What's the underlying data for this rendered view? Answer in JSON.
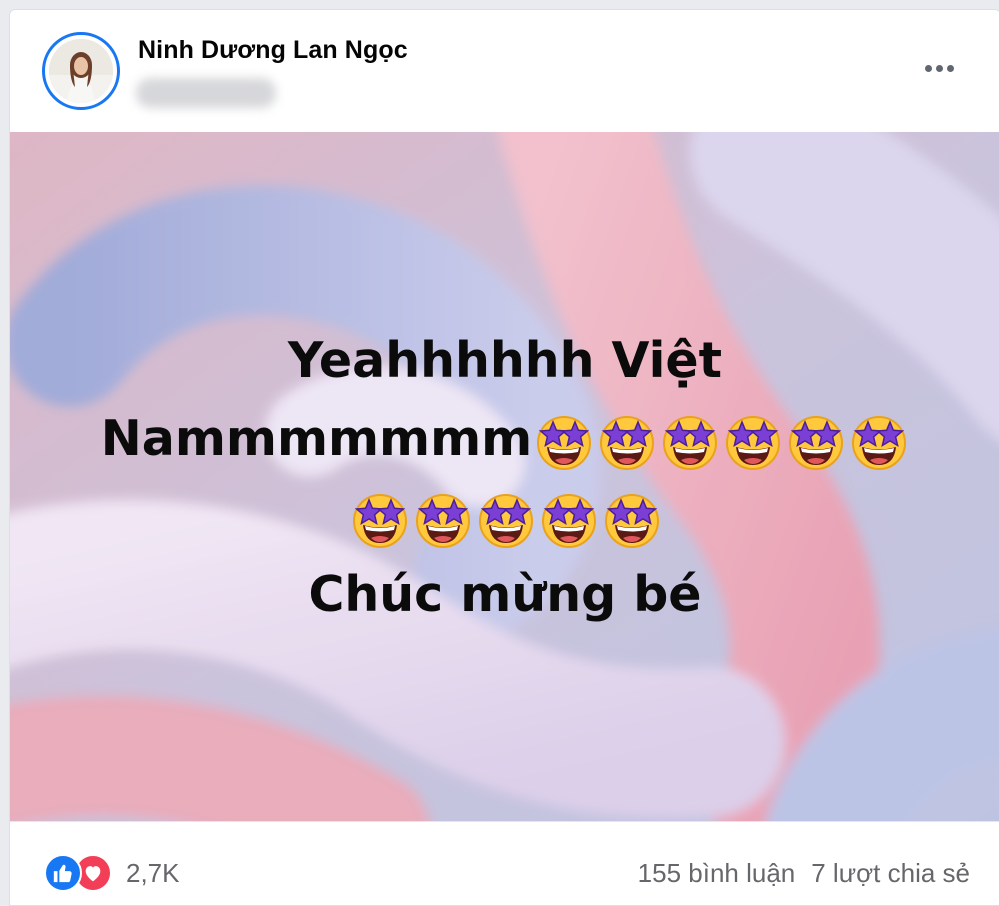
{
  "post": {
    "author_name": "Ninh Dương Lan Ngọc",
    "more_icon": "more-horizontal-icon",
    "text_line1": "Yeahhhhhh Việt",
    "text_line2": "Nammmmmmm",
    "text_line4": "Chúc mừng bé",
    "emoji_name": "star-struck",
    "emoji_count_line2": 6,
    "emoji_count_line3": 5
  },
  "footer": {
    "reactions": [
      "like-icon",
      "love-icon"
    ],
    "reaction_count": "2,7K",
    "comments": "155 bình luận",
    "shares": "7 lượt chia sẻ"
  },
  "colors": {
    "like": "#1877f2",
    "love": "#f33e58",
    "avatar_ring": "#1877f2",
    "secondary_text": "#65676b"
  }
}
